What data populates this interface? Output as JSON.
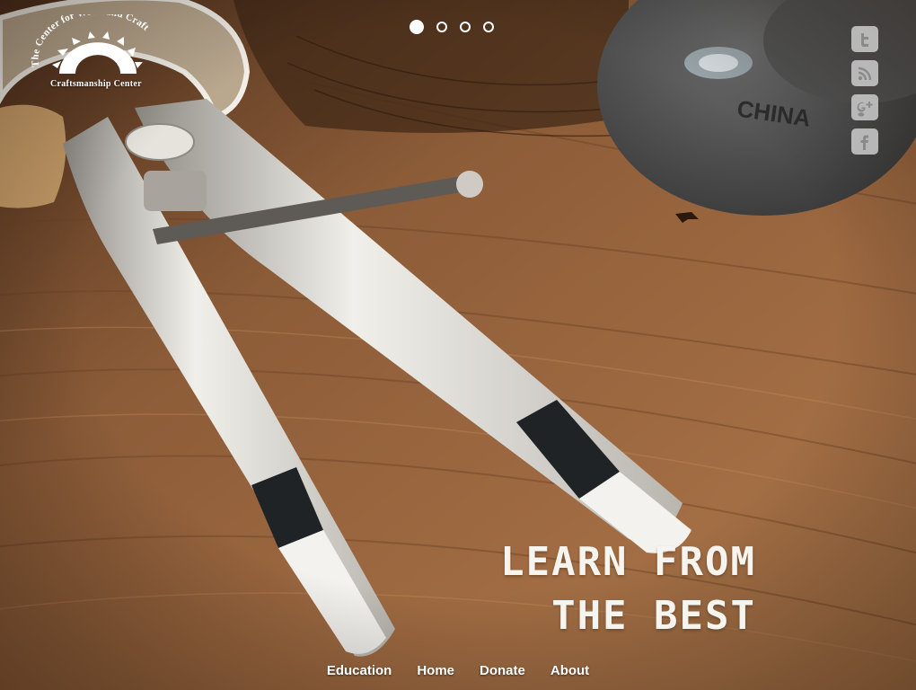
{
  "logo": {
    "arc_text": "The Center for Wood and Craft",
    "bottom_text": "Craftsmanship Center"
  },
  "slider": {
    "dots": [
      "slide-1",
      "slide-2",
      "slide-3",
      "slide-4"
    ],
    "active_index": 0
  },
  "social": [
    {
      "name": "twitter-icon",
      "glyph": "t"
    },
    {
      "name": "rss-icon",
      "glyph": "rss"
    },
    {
      "name": "google-plus-icon",
      "glyph": "g+"
    },
    {
      "name": "facebook-icon",
      "glyph": "f"
    }
  ],
  "hero": {
    "line1": "LEARN FROM",
    "line2": "THE BEST"
  },
  "nav": {
    "education": "Education",
    "home": "Home",
    "donate": "Donate",
    "about": "About"
  },
  "colors": {
    "wood": "#8a5a36",
    "wood_dark": "#5c3820",
    "metal": "#d9d6cf",
    "text": "#ffffff"
  }
}
